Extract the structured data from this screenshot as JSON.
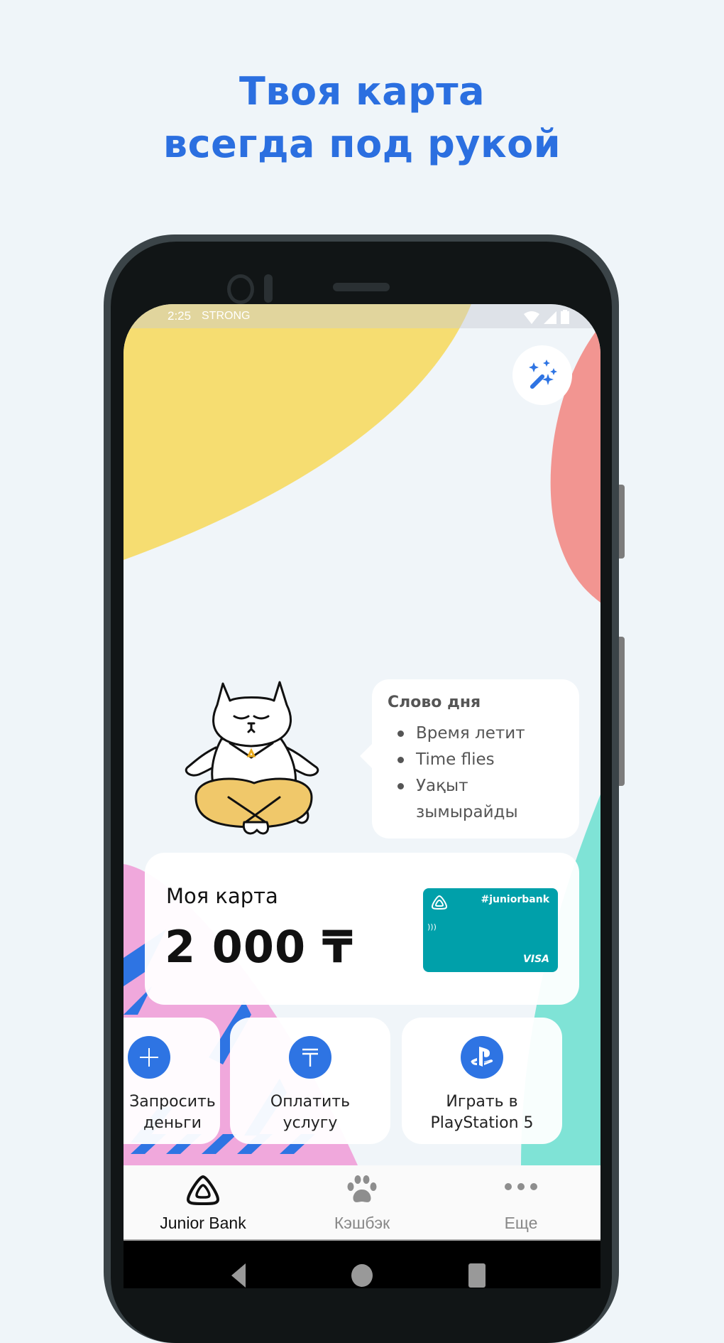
{
  "promo": {
    "title_line1": "Твоя карта",
    "title_line2": "всегда под рукой"
  },
  "status_bar": {
    "time": "2:25",
    "carrier": "STRONG",
    "icons": [
      "wifi-icon",
      "signal-icon",
      "battery-icon"
    ]
  },
  "magic_button": {
    "icon": "magic-wand-icon"
  },
  "word_of_day": {
    "title": "Слово дня",
    "items": [
      "Время летит",
      "Time flies",
      "Уақыт",
      "зымырайды"
    ]
  },
  "my_card": {
    "label": "Моя карта",
    "balance": "2 000 ₸",
    "card_tag": "#juniorbank",
    "card_network": "VISA",
    "card_color": "#00a0aa"
  },
  "actions": [
    {
      "icon": "plus-icon",
      "line1": "Запросить",
      "line2": "деньги"
    },
    {
      "icon": "tenge-icon",
      "line1": "Оплатить",
      "line2": "услугу"
    },
    {
      "icon": "playstation-icon",
      "line1": "Играть в",
      "line2": "PlayStation 5"
    }
  ],
  "tabs": [
    {
      "icon": "junior-bank-logo-icon",
      "label": "Junior Bank",
      "active": true
    },
    {
      "icon": "paw-icon",
      "label": "Кэшбэк",
      "active": false
    },
    {
      "icon": "more-dots-icon",
      "label": "Еще",
      "active": false
    }
  ],
  "nav_buttons": [
    "back-icon",
    "home-icon",
    "recents-icon"
  ],
  "colors": {
    "accent": "#2e74e3",
    "title": "#2b6fe0",
    "yellow_shape": "#f6dd71",
    "coral_shape": "#f29591",
    "pink_shape": "#f0a8dc",
    "teal_shape": "#7fe3d6"
  }
}
